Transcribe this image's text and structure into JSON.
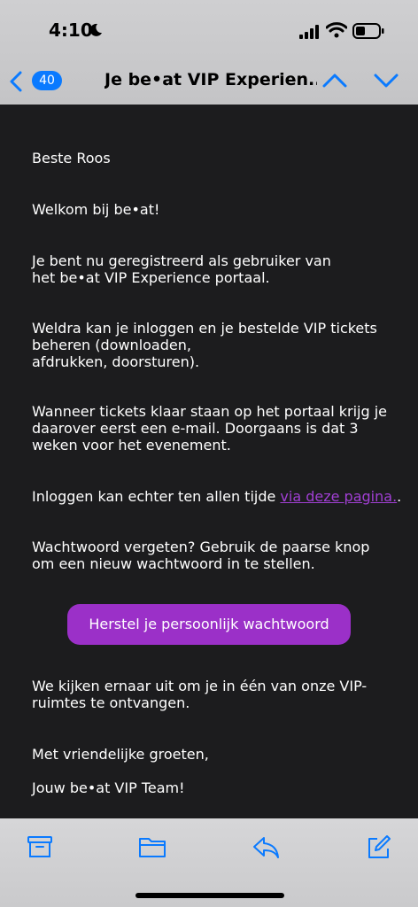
{
  "status_bar": {
    "time": "4:10",
    "icons": [
      "moon-icon",
      "signal-icon",
      "wifi-icon",
      "battery-icon"
    ]
  },
  "nav": {
    "back_count": "40",
    "title": "Je be•at VIP Experien...",
    "icons": [
      "chevron-left-icon",
      "chevron-up-icon",
      "chevron-down-icon"
    ]
  },
  "email": {
    "greeting": "Beste Roos",
    "welcome": "Welkom bij be•at!",
    "registered_line1": "Je bent nu geregistreerd als gebruiker van",
    "registered_line2": "het be•at VIP Experience portaal.",
    "soon_line1": "Weldra kan je inloggen en je bestelde VIP tickets",
    "soon_line2": "beheren (downloaden,",
    "soon_line3": "afdrukken, doorsturen).",
    "tickets_line1": "Wanneer tickets klaar staan op het portaal krijg je",
    "tickets_line2": "daarover eerst een e-mail. Doorgaans is dat 3",
    "tickets_line3": "weken voor het evenement.",
    "login_prefix": "Inloggen kan echter ten allen tijde ",
    "login_link": "via deze pagina.",
    "login_suffix": ".",
    "forgot_line1": "Wachtwoord vergeten? Gebruik de paarse knop",
    "forgot_line2": "om een nieuw wachtwoord in te stellen.",
    "button_label": "Herstel je persoonlijk wachtwoord",
    "looking_line1": "We kijken ernaar uit om je in één van onze VIP-",
    "looking_line2": "ruimtes te ontvangen.",
    "regards": "Met vriendelijke groeten,",
    "signature": "Jouw be•at VIP Team!"
  },
  "toolbar": {
    "icons": [
      "archive-icon",
      "folder-icon",
      "reply-icon",
      "compose-icon"
    ]
  },
  "colors": {
    "accent_blue": "#0a7aff",
    "button_purple": "#9b30c8",
    "link_purple": "#a13fd4",
    "background": "#1c1c1e"
  }
}
